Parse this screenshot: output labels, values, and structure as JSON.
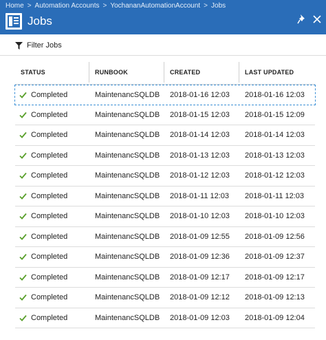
{
  "breadcrumb": [
    "Home",
    "Automation Accounts",
    "YochananAutomationAccount",
    "Jobs"
  ],
  "breadcrumb_separator": ">",
  "blade": {
    "title": "Jobs",
    "icon": "jobs-list-icon"
  },
  "toolbar": {
    "filter_label": "Filter Jobs"
  },
  "table": {
    "columns": [
      "STATUS",
      "RUNBOOK",
      "CREATED",
      "LAST UPDATED"
    ],
    "rows": [
      {
        "status": "Completed",
        "runbook": "MaintenancSQLDB",
        "created": "2018-01-16 12:03",
        "last_updated": "2018-01-16 12:03"
      },
      {
        "status": "Completed",
        "runbook": "MaintenancSQLDB",
        "created": "2018-01-15 12:03",
        "last_updated": "2018-01-15 12:09"
      },
      {
        "status": "Completed",
        "runbook": "MaintenancSQLDB",
        "created": "2018-01-14 12:03",
        "last_updated": "2018-01-14 12:03"
      },
      {
        "status": "Completed",
        "runbook": "MaintenancSQLDB",
        "created": "2018-01-13 12:03",
        "last_updated": "2018-01-13 12:03"
      },
      {
        "status": "Completed",
        "runbook": "MaintenancSQLDB",
        "created": "2018-01-12 12:03",
        "last_updated": "2018-01-12 12:03"
      },
      {
        "status": "Completed",
        "runbook": "MaintenancSQLDB",
        "created": "2018-01-11 12:03",
        "last_updated": "2018-01-11 12:03"
      },
      {
        "status": "Completed",
        "runbook": "MaintenancSQLDB",
        "created": "2018-01-10 12:03",
        "last_updated": "2018-01-10 12:03"
      },
      {
        "status": "Completed",
        "runbook": "MaintenancSQLDB",
        "created": "2018-01-09 12:55",
        "last_updated": "2018-01-09 12:56"
      },
      {
        "status": "Completed",
        "runbook": "MaintenancSQLDB",
        "created": "2018-01-09 12:36",
        "last_updated": "2018-01-09 12:37"
      },
      {
        "status": "Completed",
        "runbook": "MaintenancSQLDB",
        "created": "2018-01-09 12:17",
        "last_updated": "2018-01-09 12:17"
      },
      {
        "status": "Completed",
        "runbook": "MaintenancSQLDB",
        "created": "2018-01-09 12:12",
        "last_updated": "2018-01-09 12:13"
      },
      {
        "status": "Completed",
        "runbook": "MaintenancSQLDB",
        "created": "2018-01-09 12:03",
        "last_updated": "2018-01-09 12:04"
      }
    ]
  },
  "colors": {
    "header_blue": "#2a6db8",
    "success_green": "#5aa02c",
    "selection_dash": "#3a8fd6"
  }
}
